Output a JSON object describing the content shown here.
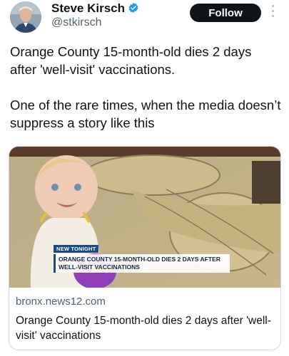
{
  "author": {
    "display_name": "Steve Kirsch",
    "handle": "@stkirsch",
    "verified": true,
    "verified_icon": "verified-badge-icon"
  },
  "actions": {
    "follow_label": "Follow",
    "more_icon": "more-dots-icon"
  },
  "tweet": {
    "paragraphs": [
      "Orange County 15-month-old dies 2 days after 'well-visit' vaccinations.",
      "One of the rare times, when the media doesn’t suppress a story like this"
    ]
  },
  "link_card": {
    "image": {
      "tag": "NEW TONIGHT",
      "headline": "ORANGE COUNTY 15-MONTH-OLD DIES 2 DAYS AFTER WELL-VISIT VACCINATIONS"
    },
    "domain": "bronx.news12.com",
    "title": "Orange County 15-month-old dies 2 days after 'well-visit' vaccinations"
  },
  "colors": {
    "text": "#0f1419",
    "secondary_text": "#536471",
    "verified_blue": "#1d9bf0",
    "follow_button_bg": "#0f1419",
    "news_blue": "#1c4a86"
  }
}
